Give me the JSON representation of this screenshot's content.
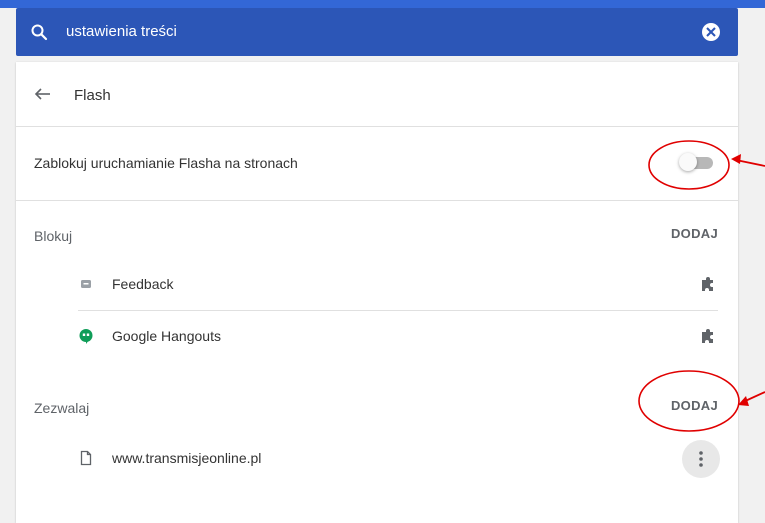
{
  "search": {
    "query": "ustawienia treści"
  },
  "header": {
    "title": "Flash"
  },
  "toggle_row": {
    "label": "Zablokuj uruchamianie Flasha na stronach",
    "enabled": false
  },
  "block_section": {
    "label": "Blokuj",
    "add_label": "DODAJ",
    "items": [
      {
        "name": "Feedback",
        "icon": "feedback-extension-icon"
      },
      {
        "name": "Google Hangouts",
        "icon": "hangouts-icon"
      }
    ]
  },
  "allow_section": {
    "label": "Zezwalaj",
    "add_label": "DODAJ",
    "items": [
      {
        "name": "www.transmisjeonline.pl",
        "icon": "file-icon"
      }
    ]
  },
  "colors": {
    "accent": "#3367d6",
    "annotation": "#e00000",
    "hangouts": "#0f9d58"
  }
}
